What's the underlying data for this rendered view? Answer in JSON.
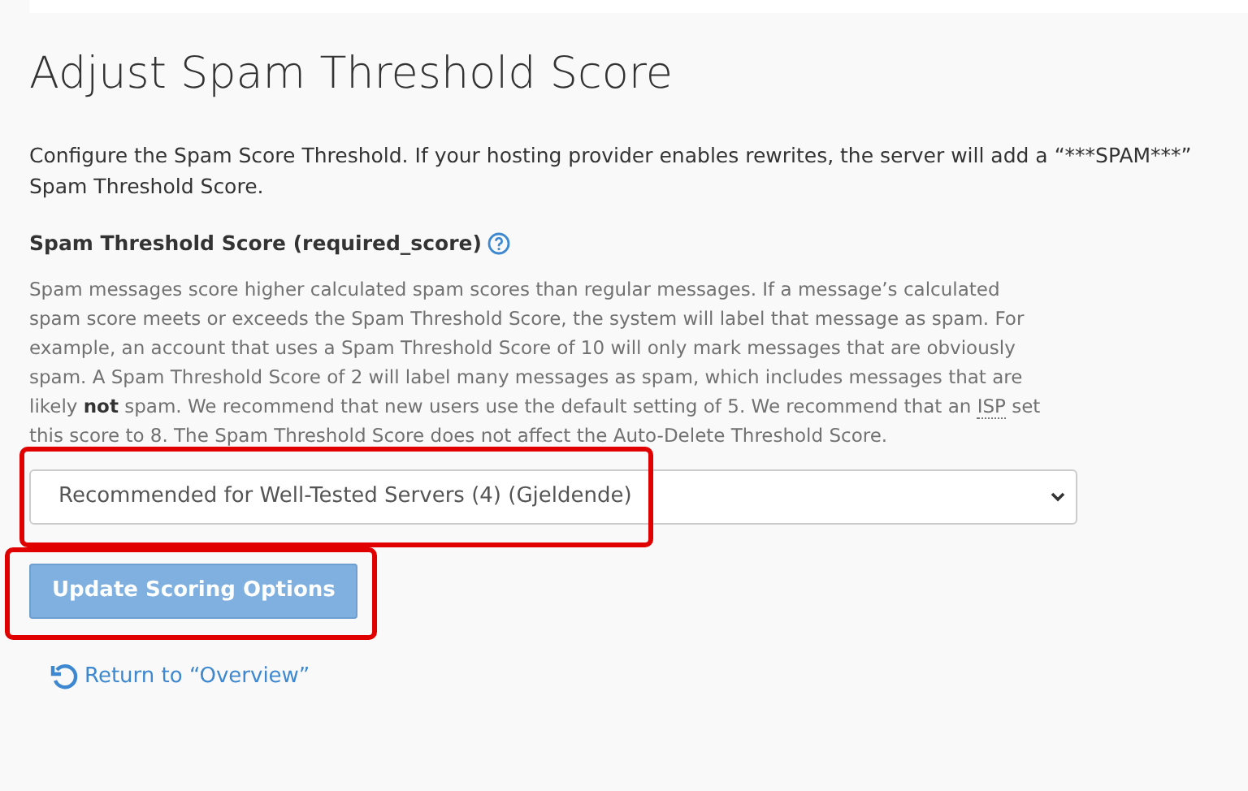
{
  "title": "Adjust Spam Threshold Score",
  "intro_lines": [
    "Configure the Spam Score Threshold. If your hosting provider enables rewrites, the server will add a “***SPAM***”",
    "Spam Threshold Score."
  ],
  "field": {
    "label": "Spam Threshold Score (required_score)",
    "description": [
      {
        "kind": "plain",
        "text": "Spam messages score higher calculated spam scores than regular messages. If a message’s calculated spam score meets or exceeds the Spam Threshold Score, the system will label that message as spam. For example, an account that uses a Spam Threshold Score of 10 will only mark messages that are obviously spam. A Spam Threshold Score of 2 will label many messages as spam, which includes messages that are likely "
      },
      {
        "kind": "bold",
        "text": "not"
      },
      {
        "kind": "plain",
        "text": " spam. We recommend that new users use the default setting of 5. We recommend that an "
      },
      {
        "kind": "abbr",
        "text": "ISP"
      },
      {
        "kind": "plain",
        "text": " set this score to 8. The Spam Threshold Score does not affect the Auto-Delete Threshold Score."
      }
    ],
    "value": "Recommended for Well-Tested Servers (4) (Gjeldende)",
    "highlighted": true
  },
  "submit": {
    "label": "Update Scoring Options",
    "disabled": true,
    "highlighted": true
  },
  "return_link": "Return to “Overview”"
}
